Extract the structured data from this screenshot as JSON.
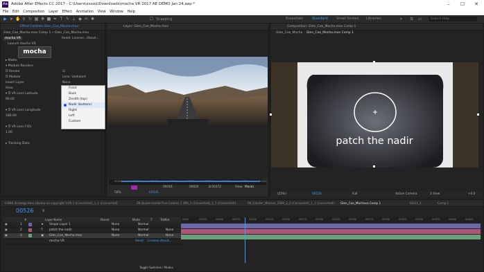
{
  "window": {
    "title": "Adobe After Effects CC 2017 - C:\\Users\\xxxxx\\Downloads\\mocha VR 2017 AE DEMO Jan 24.aep *",
    "app_icon": "Ae",
    "minimize": "–",
    "maximize": "☐",
    "close": "✕"
  },
  "menu": [
    "File",
    "Edit",
    "Composition",
    "Layer",
    "Effect",
    "Animation",
    "View",
    "Window",
    "Help"
  ],
  "toolbar": {
    "snapping": "Snapping",
    "workspaces": [
      "Essentials",
      "Standard",
      "Small Screen",
      "Libraries"
    ],
    "active_workspace": "Standard",
    "search_placeholder": "Search Help"
  },
  "effect_controls": {
    "tab": "Effect Controls",
    "tab_layer": "Glen_Coe_Mocha.mov",
    "breadcrumb": "Glen_Coe_Mocha.mov Comp 1 • Glen_Coe_Mocha.mov",
    "effect_name": "mocha VR",
    "effect_buttons": [
      "Reset",
      "License...",
      "About..."
    ],
    "launch_label": "Launch mocha VR",
    "logo_text": "mocha",
    "rows": [
      {
        "label": "▸ Matte",
        "value": ""
      },
      {
        "label": "▾ Module Renders",
        "value": ""
      },
      {
        "label": "  Ö Render",
        "value": "☑"
      },
      {
        "label": "  Ö Module",
        "value": "Lens: Undistort"
      },
      {
        "label": "  Insert Layer",
        "value": "None"
      },
      {
        "label": "  View",
        "value": "Nadir (bottom)"
      },
      {
        "label": "  ▾ Ö VR Lens Latitude",
        "value": ""
      },
      {
        "label": "       90.00",
        "value": ""
      },
      {
        "label": "",
        "value": ""
      },
      {
        "label": "  ▾ Ö VR Lens Longitude",
        "value": ""
      },
      {
        "label": "       180.00",
        "value": ""
      },
      {
        "label": "",
        "value": ""
      },
      {
        "label": "  ▾ Ö VR Lens FOV",
        "value": ""
      },
      {
        "label": "       1.00",
        "value": ""
      },
      {
        "label": "",
        "value": ""
      },
      {
        "label": "▸ Tracking Data",
        "value": ""
      }
    ],
    "view_options": [
      {
        "label": "Front",
        "selected": false
      },
      {
        "label": "Back",
        "selected": false
      },
      {
        "label": "Zenith (top)",
        "selected": false
      },
      {
        "label": "Nadir (bottom)",
        "selected": true
      },
      {
        "label": "Right",
        "selected": false
      },
      {
        "label": "Left",
        "selected": false
      },
      {
        "label": "Custom",
        "selected": false
      }
    ]
  },
  "layer_viewer": {
    "tab": "Layer: Glen_Coe_Mocha.mov",
    "ruler_labels": [
      "00000",
      "00050",
      "00100",
      "00150",
      "00200",
      "00250",
      "00300",
      "00350",
      "00400"
    ],
    "frame_in": "00416",
    "frame_out": "00024",
    "duration": "Δ 00372",
    "view_label": "View:",
    "view_value": "Masks",
    "zoom": "50%",
    "timecode": "00526"
  },
  "comp_viewer": {
    "tab": "Composition: Glen_Coe_Mocha.mov Comp 1",
    "subtabs": [
      "Glen_Coe_Mocha",
      "Glen_Coe_Mocha.mov Comp 1"
    ],
    "overlay_text": "patch the nadir",
    "zoom": "(25%)",
    "timecode": "00526",
    "resolution": "Full",
    "camera": "Active Camera",
    "views": "1 View",
    "exposure": "+0.0"
  },
  "timeline": {
    "tabs": [
      {
        "label": "0-B6K Strategy-Aero (Ikuma no copyright V.05 1 (Converted)_1_1 (Converted)",
        "active": false
      },
      {
        "label": "Z8 Queen-Inside-Five-Coloms 1 (MA_1 (Converted)_1_1 (Converted))",
        "active": false
      },
      {
        "label": "06_Glenfer_Mission_1000_2_0 (Converted)_1_1 (Converted)",
        "active": false
      },
      {
        "label": "Glen_Coe_Mochava Comp 1",
        "active": true
      },
      {
        "label": "DEG3_1",
        "active": false
      },
      {
        "label": "Comp 1",
        "active": false
      }
    ],
    "timecode": "00526",
    "search_placeholder": "⚲",
    "columns": [
      "#",
      "Layer Name",
      "Parent",
      "Mode",
      "T",
      "TrkMat"
    ],
    "layers": [
      {
        "num": "1",
        "icon": "★",
        "name": "Shape Layer 1",
        "parent": "None",
        "mode": "Normal",
        "trkmat": ""
      },
      {
        "num": "2",
        "icon": "T",
        "name": "patch the nadir",
        "parent": "None",
        "mode": "Normal",
        "trkmat": "None"
      },
      {
        "num": "3",
        "icon": "▣",
        "name": "Glen_Coe_Mocha.mov",
        "parent": "None",
        "mode": "Normal",
        "trkmat": "None"
      }
    ],
    "sub_label": "mocha VR",
    "sub_buttons": [
      "Reset",
      "License...",
      "About..."
    ],
    "ruler_labels": [
      "0000",
      "00025",
      "00050",
      "00075",
      "00100",
      "00125",
      "00150",
      "00175",
      "00200",
      "00225",
      "00250",
      "00275",
      "00300",
      "00325",
      "00350",
      "00375",
      "00400",
      "00425"
    ],
    "toggle_label": "Toggle Switches / Modes",
    "layer_colors": [
      "#6a6aa8",
      "#b0567a",
      "#6aa07a"
    ]
  }
}
